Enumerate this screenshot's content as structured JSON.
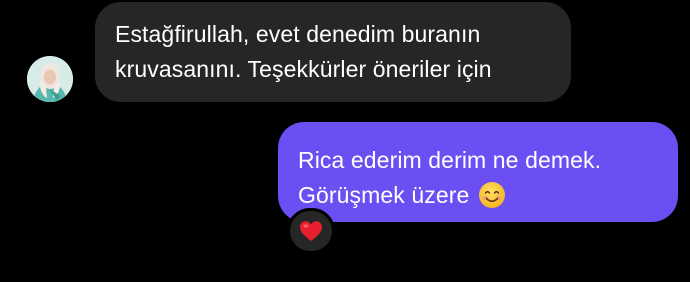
{
  "thread": {
    "incoming": {
      "sender_avatar": "contact-avatar",
      "lines": [
        "Estağfirullah, evet denedim buranın",
        "kruvasanını. Teşekkürler öneriler için"
      ]
    },
    "outgoing": {
      "lines": [
        "Rica ederim derim ne demek.",
        "Görüşmek üzere"
      ],
      "emoji": "smiling-face-emoji",
      "reaction": "red-heart-icon"
    }
  },
  "colors": {
    "background": "#000000",
    "incoming_bubble": "#262626",
    "outgoing_bubble": "#6b4ff2",
    "text": "#ffffff",
    "heart": "#e8202e"
  }
}
